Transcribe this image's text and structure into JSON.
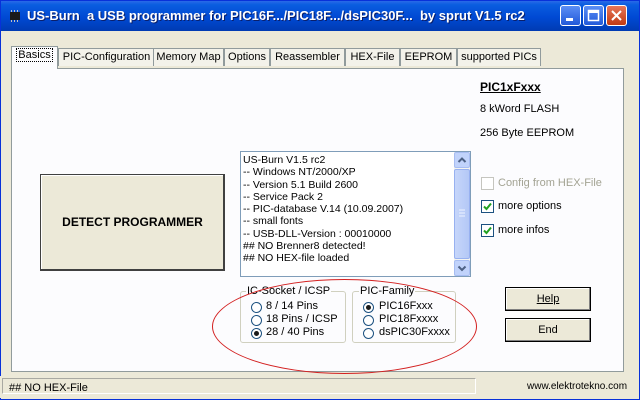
{
  "window": {
    "title": "US-Burn  a USB programmer for PIC16F.../PIC18F.../dsPIC30F...  by sprut V1.5 rc2"
  },
  "tabs": [
    {
      "label": "Basics",
      "active": true
    },
    {
      "label": "PIC-Configuration"
    },
    {
      "label": "Memory Map"
    },
    {
      "label": "Options"
    },
    {
      "label": "Reassembler"
    },
    {
      "label": "HEX-File"
    },
    {
      "label": "EEPROM"
    },
    {
      "label": "supported PICs"
    }
  ],
  "chip_info": {
    "name": "PIC1xFxxx",
    "flash": "8 kWord FLASH",
    "eeprom": "256 Byte EEPROM"
  },
  "detect_button": "DETECT PROGRAMMER",
  "log": [
    "US-Burn V1.5 rc2",
    "-- Windows NT/2000/XP",
    "-- Version 5.1 Build 2600",
    "-- Service Pack 2",
    "-- PIC-database V.14 (10.09.2007)",
    "-- small fonts",
    "-- USB-DLL-Version : 00010000",
    "##  NO Brenner8 detected!",
    "## NO HEX-file loaded"
  ],
  "options": [
    {
      "label": "Config from HEX-File",
      "checked": false,
      "enabled": false
    },
    {
      "label": "more options",
      "checked": true,
      "enabled": true
    },
    {
      "label": "more infos",
      "checked": true,
      "enabled": true
    }
  ],
  "ic_socket": {
    "title": "IC-Socket / ICSP",
    "items": [
      {
        "label": "8 / 14 Pins",
        "selected": false
      },
      {
        "label": "18 Pins / ICSP",
        "selected": false
      },
      {
        "label": "28 / 40 Pins",
        "selected": true
      }
    ]
  },
  "pic_family": {
    "title": "PIC-Family",
    "items": [
      {
        "label": "PIC16Fxxx",
        "selected": true
      },
      {
        "label": "PIC18Fxxxx",
        "selected": false
      },
      {
        "label": "dsPIC30Fxxxx",
        "selected": false
      }
    ]
  },
  "buttons": {
    "help": "Help",
    "end": "End"
  },
  "status": {
    "text": "## NO HEX-File"
  },
  "watermark": "www.elektrotekno.com"
}
